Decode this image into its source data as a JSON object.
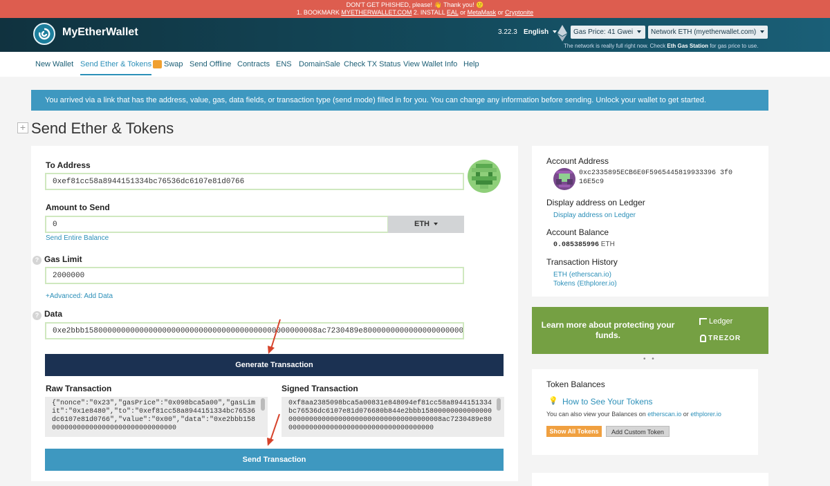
{
  "phishing": {
    "line1_a": "DON'T GET PHISHED, please! ",
    "line1_b": " Thank you! ",
    "line2_a": "1. BOOKMARK ",
    "bookmark_link": "MYETHERWALLET.COM",
    "line2_b": "    2. INSTALL ",
    "eal_link": "EAL",
    "or1": " or ",
    "metamask_link": "MetaMask",
    "or2": " or ",
    "cryptonite_link": "Cryptonite"
  },
  "header": {
    "brand": "MyEtherWallet",
    "version": "3.22.3",
    "language": "English",
    "gas_price": "Gas Price: 41 Gwei",
    "network": "Network ETH (myetherwallet.com)",
    "note_a": "The network is really full right now. Check ",
    "note_link": "Eth Gas Station",
    "note_b": " for gas price to use."
  },
  "nav": {
    "items": [
      "New Wallet",
      "Send Ether & Tokens",
      "Swap",
      "Send Offline",
      "Contracts",
      "ENS",
      "DomainSale",
      "Check TX Status",
      "View Wallet Info",
      "Help"
    ]
  },
  "notice": "You arrived via a link that has the address, value, gas, data fields, or transaction type (send mode) filled in for you. You can change any information before sending. Unlock your wallet to get started.",
  "page_title": "Send Ether & Tokens",
  "form": {
    "to_label": "To Address",
    "to_value": "0xef81cc58a8944151334bc76536dc6107e81d0766",
    "amount_label": "Amount to Send",
    "amount_value": "0",
    "currency": "ETH",
    "send_entire": "Send Entire Balance",
    "gas_label": "Gas Limit",
    "gas_value": "2000000",
    "advanced": "+Advanced: Add Data",
    "data_label": "Data",
    "data_value": "0xe2bbb158000000000000000000000000000000000000000000000008ac7230489e8000000000000000000000000",
    "generate_btn": "Generate Transaction",
    "raw_label": "Raw Transaction",
    "raw_value": "{\"nonce\":\"0x23\",\"gasPrice\":\"0x098bca5a00\",\"gasLimit\":\"0x1e8480\",\"to\":\"0xef81cc58a8944151334bc76536dc6107e81d0766\",\"value\":\"0x00\",\"data\":\"0xe2bbb158000000000000000000000000000000",
    "signed_label": "Signed Transaction",
    "signed_value": "0xf8aa2385098bca5a00831e848094ef81cc58a8944151334bc76536dc6107e81d076680b844e2bbb158000000000000000000000000000000000000000000000000008ac7230489e8000000000000000000000000000000000000",
    "send_btn": "Send Transaction",
    "help_glyph": "?"
  },
  "account": {
    "address_label": "Account Address",
    "address": "0xc2335895ECB6E0F5965445819933396 3f016E5c9",
    "ledger_label": "Display address on Ledger",
    "ledger_link": "Display address on Ledger",
    "balance_label": "Account Balance",
    "balance_value": "0.085385996",
    "balance_unit": "ETH",
    "history_label": "Transaction History",
    "history_eth": "ETH (etherscan.io)",
    "history_tokens": "Tokens (Ethplorer.io)"
  },
  "promo": {
    "text": "Learn more about protecting your funds.",
    "ledger": "Ledger",
    "trezor": "TREZOR",
    "dots": "• •"
  },
  "tokens": {
    "title": "Token Balances",
    "how_to": "How to See Your Tokens",
    "view_a": "You can also view your Balances on ",
    "etherscan": "etherscan.io",
    "or": " or ",
    "ethplorer": "ethplorer.io",
    "show_all": "Show All Tokens",
    "add_custom": "Add Custom Token"
  },
  "colors": {
    "phish_red": "#dd5d4f",
    "header_dark": "#10323f",
    "accent_blue": "#3e98c0",
    "navy_button": "#1b3152",
    "promo_green": "#75a043",
    "field_border": "#cfe8bf",
    "orange": "#f0a040",
    "annotation_arrow": "#d6432b"
  }
}
